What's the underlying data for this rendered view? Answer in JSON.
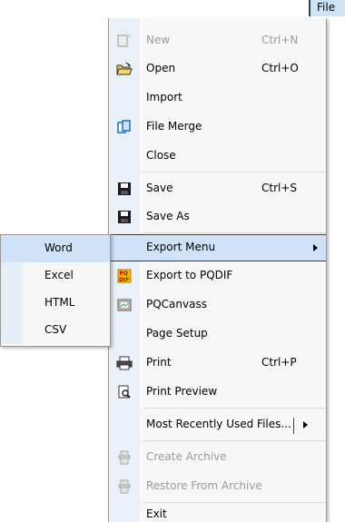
{
  "menubar": {
    "file_label": "File"
  },
  "menu": {
    "items": [
      {
        "label": "New",
        "shortcut": "Ctrl+N",
        "icon": "new-file-icon",
        "disabled": true
      },
      {
        "label": "Open",
        "shortcut": "Ctrl+O",
        "icon": "open-folder-icon"
      },
      {
        "label": "Import",
        "shortcut": ""
      },
      {
        "label": "File Merge",
        "shortcut": "",
        "icon": "file-merge-icon"
      },
      {
        "label": "Close",
        "shortcut": ""
      },
      {
        "label": "Save",
        "shortcut": "Ctrl+S",
        "icon": "save-icon"
      },
      {
        "label": "Save As",
        "shortcut": "",
        "icon": "save-icon"
      },
      {
        "label": "Export Menu",
        "shortcut": "",
        "submenu": true,
        "highlighted": true
      },
      {
        "label": "Export to PQDIF",
        "shortcut": "",
        "icon": "pqdif-icon"
      },
      {
        "label": "PQCanvass",
        "shortcut": "",
        "icon": "pqcanvass-icon"
      },
      {
        "label": "Page Setup",
        "shortcut": ""
      },
      {
        "label": "Print",
        "shortcut": "Ctrl+P",
        "icon": "printer-icon"
      },
      {
        "label": "Print Preview",
        "shortcut": "",
        "icon": "print-preview-icon"
      },
      {
        "label": "Most Recently Used Files...",
        "shortcut": "",
        "submenu": true
      },
      {
        "label": "Create Archive",
        "shortcut": "",
        "icon": "archive-icon",
        "disabled": true
      },
      {
        "label": "Restore From Archive",
        "shortcut": "",
        "icon": "archive-icon",
        "disabled": true
      },
      {
        "label": "Exit",
        "shortcut": ""
      }
    ]
  },
  "export_submenu": {
    "items": [
      {
        "label": "Word",
        "highlighted": true
      },
      {
        "label": "Excel"
      },
      {
        "label": "HTML"
      },
      {
        "label": "CSV"
      }
    ]
  },
  "colors": {
    "highlight": "#cfe2f7",
    "menu_bg": "#f7f7f7",
    "disabled_text": "#9a9a9a"
  }
}
